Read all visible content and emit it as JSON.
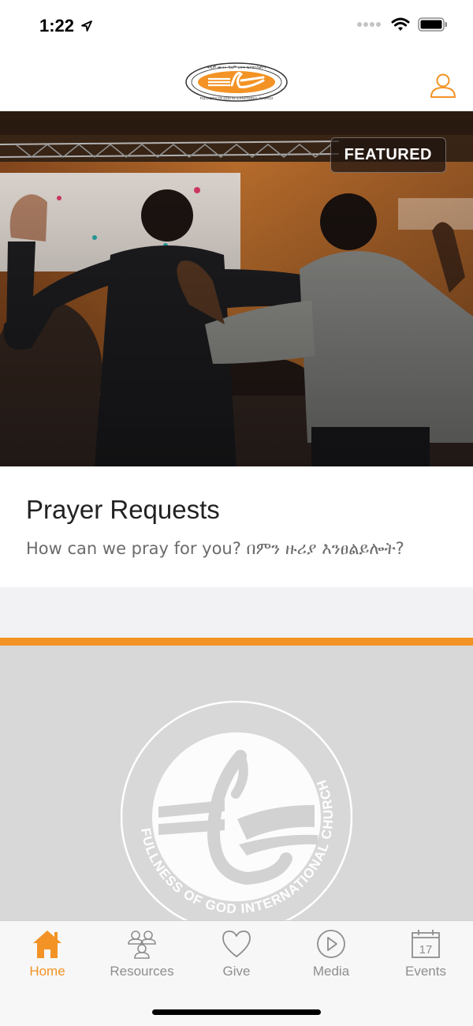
{
  "status_bar": {
    "time": "1:22"
  },
  "header": {
    "logo_alt": "FULLNESS OF GOD INTERNATIONAL CHURCH",
    "profile_icon": "person-icon"
  },
  "hero": {
    "badge": "FEATURED"
  },
  "card": {
    "title": "Prayer Requests",
    "subtitle": "How can we pray for you? በምን ዙሪያ እንፀልይሎት?"
  },
  "seal": {
    "ring_text": "FULLNESS OF GOD INTERNATIONAL CHURCH"
  },
  "tabs": [
    {
      "label": "Home",
      "icon": "home-icon",
      "active": true
    },
    {
      "label": "Resources",
      "icon": "people-icon",
      "active": false
    },
    {
      "label": "Give",
      "icon": "heart-icon",
      "active": false
    },
    {
      "label": "Media",
      "icon": "play-icon",
      "active": false
    },
    {
      "label": "Events",
      "icon": "calendar-icon",
      "active": false
    }
  ],
  "colors": {
    "accent": "#f39325",
    "inactive": "#8e8e8e"
  },
  "calendar_day": "17"
}
